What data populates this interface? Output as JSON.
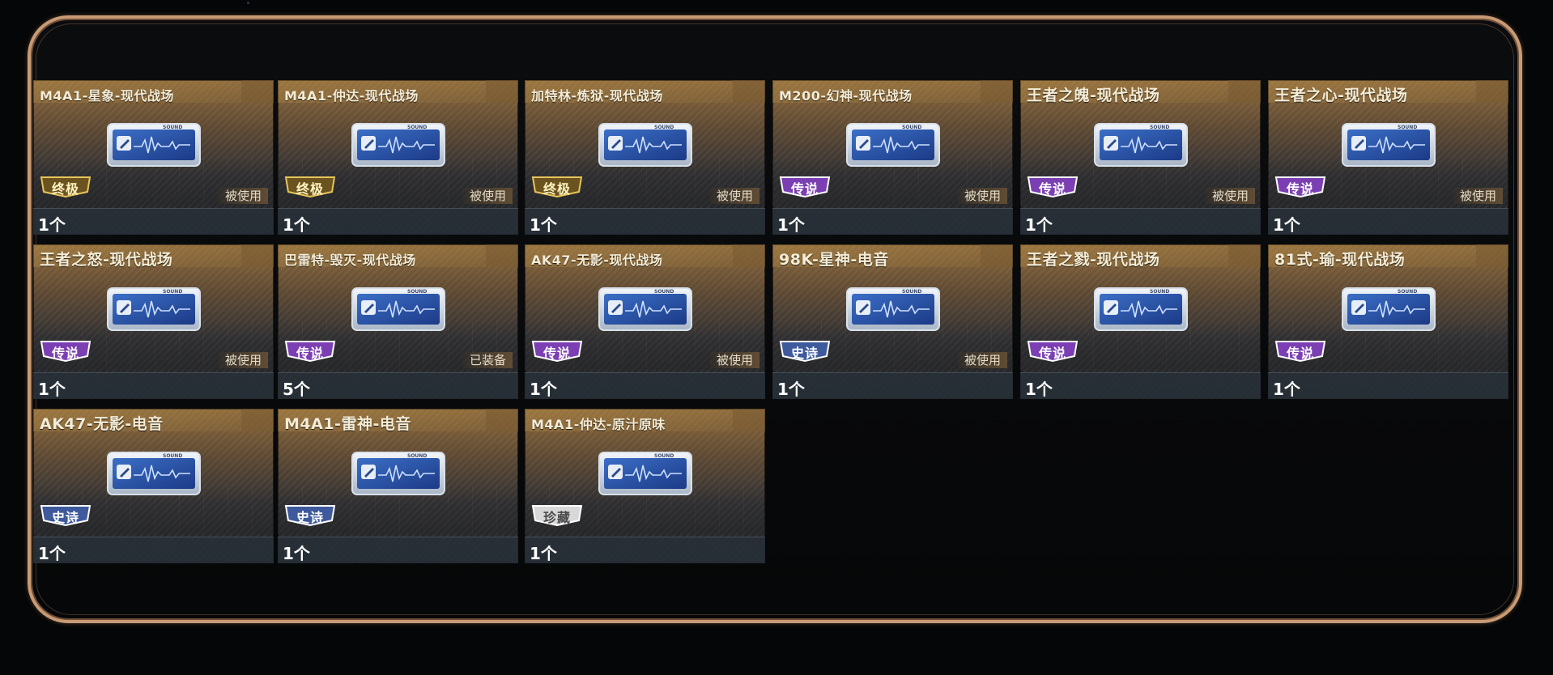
{
  "items": [
    {
      "name": "M4A1-星象-现代战场",
      "rarity": "终极",
      "status": "被使用",
      "count": "1个"
    },
    {
      "name": "M4A1-仲达-现代战场",
      "rarity": "终极",
      "status": "被使用",
      "count": "1个"
    },
    {
      "name": "加特林-炼狱-现代战场",
      "rarity": "终极",
      "status": "被使用",
      "count": "1个"
    },
    {
      "name": "M200-幻神-现代战场",
      "rarity": "传说",
      "status": "被使用",
      "count": "1个"
    },
    {
      "name": "王者之魄-现代战场",
      "rarity": "传说",
      "status": "被使用",
      "count": "1个"
    },
    {
      "name": "王者之心-现代战场",
      "rarity": "传说",
      "status": "被使用",
      "count": "1个"
    },
    {
      "name": "王者之怒-现代战场",
      "rarity": "传说",
      "status": "被使用",
      "count": "1个"
    },
    {
      "name": "巴雷特-毁灭-现代战场",
      "rarity": "传说",
      "status": "已装备",
      "count": "5个"
    },
    {
      "name": "AK47-无影-现代战场",
      "rarity": "传说",
      "status": "被使用",
      "count": "1个"
    },
    {
      "name": "98K-星神-电音",
      "rarity": "史诗",
      "status": "被使用",
      "count": "1个"
    },
    {
      "name": "王者之戮-现代战场",
      "rarity": "传说",
      "status": "",
      "count": "1个"
    },
    {
      "name": "81式-瑜-现代战场",
      "rarity": "传说",
      "status": "",
      "count": "1个"
    },
    {
      "name": "AK47-无影-电音",
      "rarity": "史诗",
      "status": "",
      "count": "1个"
    },
    {
      "name": "M4A1-雷神-电音",
      "rarity": "史诗",
      "status": "",
      "count": "1个"
    },
    {
      "name": "M4A1-仲达-原汁原味",
      "rarity": "珍藏",
      "status": "",
      "count": "1个"
    }
  ],
  "sound_card": {
    "label": "SOUND",
    "icon": "sound-waveform-icon"
  },
  "rarity_colors": {
    "终极": "#c9a23a",
    "传说": "#7b3fb3",
    "史诗": "#3e5a9c",
    "珍藏": "#d8d8d8"
  }
}
